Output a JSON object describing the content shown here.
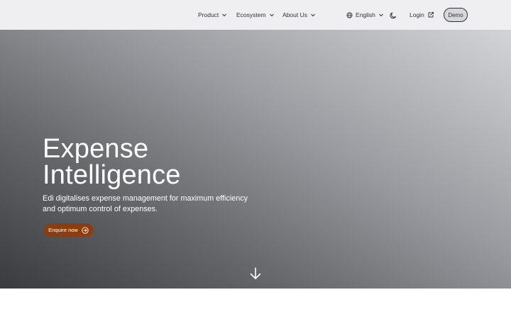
{
  "header": {
    "nav": [
      {
        "label": "Product",
        "icon": "chevron-down-icon"
      },
      {
        "label": "Ecosystem",
        "icon": "chevron-down-icon"
      },
      {
        "label": "About Us",
        "icon": "chevron-down-icon"
      }
    ],
    "language": {
      "label": "English",
      "icon": "globe-icon"
    },
    "theme_toggle_icon": "moon-icon",
    "login": {
      "label": "Login",
      "icon": "external-link-icon"
    },
    "demo_label": "Demo"
  },
  "hero": {
    "title_lines": [
      "Expense",
      "Intelligence"
    ],
    "subtitle_lines": [
      "Edi digitalises expense management for maximum efficiency",
      "and optimum control of expenses."
    ],
    "cta": {
      "label": "Enquire now",
      "icon": "arrow-right-circle-icon"
    },
    "scroll_icon": "arrow-down-icon"
  },
  "colors": {
    "header_bg": "#efeff1",
    "text_dark": "#2f3137",
    "cta_bg": "#8e3c0c",
    "hero_text": "#ffffff"
  }
}
